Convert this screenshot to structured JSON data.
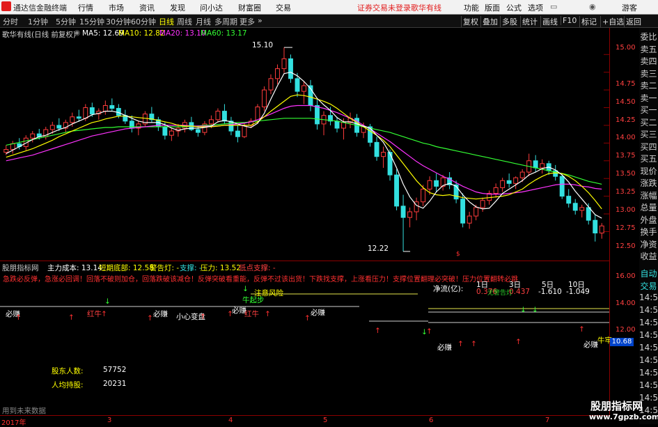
{
  "menubar": {
    "app_title": "通达信金融终端",
    "items": [
      "行情",
      "市场",
      "资讯",
      "发现",
      "问小达",
      "财富圈",
      "交易"
    ],
    "warning": "证券交易未登录",
    "stock_tag": "歌华有线",
    "right_items": [
      "功能",
      "版面",
      "公式",
      "选项"
    ],
    "user": "游客"
  },
  "toolbar": {
    "periods": [
      "分时",
      "1分钟",
      "5分钟",
      "15分钟",
      "30分钟",
      "60分钟",
      "日线",
      "周线",
      "月线",
      "多周期",
      "更多"
    ],
    "selected_period": "日线",
    "buttons": [
      "复权",
      "叠加",
      "多股",
      "统计",
      "画线",
      "F10",
      "标记",
      "+自选",
      "返回"
    ]
  },
  "infobar": {
    "title": "歌华有线(日线 前复权)",
    "ma5": "MA5: 12.69",
    "ma10": "MA10: 12.82",
    "ma20": "MA20: 13.10",
    "ma60": "MA60: 13.17"
  },
  "annotations": {
    "high": "15.10",
    "low": "12.22",
    "marker": "$"
  },
  "price_axis": [
    "15.00",
    "14.75",
    "14.50",
    "14.25",
    "14.00",
    "13.75",
    "13.50",
    "13.25",
    "13.00",
    "12.75",
    "12.50"
  ],
  "indicator_header": {
    "name": "股朋指标网",
    "cost": "主力成本: 13.14",
    "bottom": "短期底部: 12.58",
    "alarm": "警告灯: -",
    "support": "支撑: -",
    "pressure": "压力: 13.52",
    "low_support": "低点支撑: -"
  },
  "indicator_banner": "急跌必反弹，急涨必回调！回落不破则加仓，回落跌破该减仓！反弹突破看重能，反弹不过该出货！下跌找支撑，上涨看压力！支撑位置翻理必突破！压力位置翻转必跳跃！",
  "indicator_labels": {
    "careful": "小心变盘",
    "risk": "注意风险",
    "bull": "牛起步",
    "must_earn": "必赚",
    "red_cow": "红牛",
    "bull_strong": "牛牢"
  },
  "net_flow": {
    "label": "净流(亿):",
    "periods": [
      "1日",
      "3日",
      "5日",
      "10日"
    ],
    "values": [
      "0.376",
      "0.437",
      "-1.610",
      "-1.049"
    ],
    "extra": "无警告灯"
  },
  "holders": {
    "count_label": "股东人数:",
    "count_value": "57752",
    "avg_label": "人均持股:",
    "avg_value": "20231"
  },
  "indicator_axis": [
    "16.00",
    "14.00",
    "12.00"
  ],
  "indicator_value": "10.68",
  "hint": "用到未来数据",
  "dates": [
    "2017年",
    "3",
    "4",
    "5",
    "6",
    "7"
  ],
  "right_panel": {
    "top": [
      "委比",
      "卖五",
      "卖四",
      "卖三",
      "卖二",
      "卖一",
      "买一",
      "买二",
      "买三",
      "买四",
      "买五",
      "现价",
      "涨跌",
      "涨幅",
      "总量",
      "外盘",
      "换手",
      "净资",
      "收益"
    ],
    "bottom": [
      "自动",
      "交易",
      "14:5",
      "14:5",
      "14:5",
      "14:5",
      "14:5",
      "14:5",
      "14:5",
      "14:5",
      "14:5",
      "14:5"
    ]
  },
  "watermark": {
    "cn": "股朋指标网",
    "url": "www.7gpzb.com"
  },
  "colors": {
    "up": "#ff3c3c",
    "down": "#33e0e0",
    "ma5": "#ffffff",
    "ma10": "#ffff00",
    "ma20": "#ff33ff",
    "ma60": "#33ff33",
    "axis": "#8b0000"
  },
  "chart_data": {
    "type": "candlestick",
    "ohlc": [
      [
        13.62,
        13.72,
        13.58,
        13.66
      ],
      [
        13.66,
        13.78,
        13.6,
        13.74
      ],
      [
        13.74,
        13.82,
        13.66,
        13.7
      ],
      [
        13.7,
        13.86,
        13.65,
        13.82
      ],
      [
        13.82,
        13.92,
        13.76,
        13.88
      ],
      [
        13.88,
        13.95,
        13.8,
        13.84
      ],
      [
        13.84,
        13.98,
        13.8,
        13.94
      ],
      [
        13.94,
        14.05,
        13.88,
        14.0
      ],
      [
        14.0,
        14.1,
        13.92,
        13.96
      ],
      [
        13.96,
        14.08,
        13.9,
        14.04
      ],
      [
        14.04,
        14.18,
        13.98,
        14.12
      ],
      [
        14.12,
        14.22,
        14.05,
        14.1
      ],
      [
        14.1,
        14.3,
        14.06,
        14.25
      ],
      [
        14.25,
        14.32,
        14.12,
        14.16
      ],
      [
        14.16,
        14.24,
        14.08,
        14.2
      ],
      [
        14.2,
        14.35,
        14.15,
        14.28
      ],
      [
        14.28,
        14.38,
        14.2,
        14.24
      ],
      [
        14.24,
        14.3,
        14.1,
        14.14
      ],
      [
        14.14,
        14.22,
        14.02,
        14.06
      ],
      [
        14.06,
        14.14,
        13.9,
        13.96
      ],
      [
        13.96,
        14.06,
        13.86,
        14.02
      ],
      [
        14.02,
        14.2,
        13.98,
        14.16
      ],
      [
        14.16,
        14.26,
        14.04,
        14.08
      ],
      [
        14.08,
        14.12,
        13.92,
        13.98
      ],
      [
        13.98,
        14.04,
        13.8,
        13.86
      ],
      [
        13.86,
        13.96,
        13.78,
        13.92
      ],
      [
        13.92,
        14.02,
        13.84,
        13.96
      ],
      [
        13.96,
        14.08,
        13.9,
        14.04
      ],
      [
        14.04,
        14.12,
        13.92,
        13.94
      ],
      [
        13.94,
        14.0,
        13.84,
        13.9
      ],
      [
        13.9,
        14.06,
        13.86,
        14.02
      ],
      [
        14.02,
        14.14,
        13.96,
        14.08
      ],
      [
        14.08,
        14.24,
        14.04,
        14.2
      ],
      [
        14.2,
        14.3,
        14.02,
        14.06
      ],
      [
        14.06,
        14.12,
        13.86,
        13.92
      ],
      [
        13.92,
        14.0,
        13.76,
        13.84
      ],
      [
        13.84,
        14.04,
        13.82,
        14.0
      ],
      [
        14.0,
        14.1,
        13.96,
        14.06
      ],
      [
        14.06,
        14.3,
        14.02,
        14.26
      ],
      [
        14.26,
        14.55,
        14.2,
        14.5
      ],
      [
        14.5,
        14.72,
        14.44,
        14.66
      ],
      [
        14.66,
        14.86,
        14.58,
        14.8
      ],
      [
        14.8,
        15.1,
        14.74,
        14.94
      ],
      [
        14.94,
        15.0,
        14.6,
        14.66
      ],
      [
        14.66,
        14.74,
        14.4,
        14.48
      ],
      [
        14.48,
        14.62,
        14.3,
        14.56
      ],
      [
        14.56,
        14.64,
        14.2,
        14.28
      ],
      [
        14.28,
        14.36,
        13.94,
        14.02
      ],
      [
        14.02,
        14.2,
        13.86,
        14.14
      ],
      [
        14.14,
        14.26,
        14.0,
        14.06
      ],
      [
        14.06,
        14.12,
        13.9,
        13.96
      ],
      [
        13.96,
        14.1,
        13.8,
        14.04
      ],
      [
        14.04,
        14.18,
        13.96,
        14.1
      ],
      [
        14.1,
        14.16,
        13.84,
        13.9
      ],
      [
        13.9,
        14.04,
        13.82,
        13.98
      ],
      [
        13.98,
        14.02,
        13.7,
        13.76
      ],
      [
        13.76,
        13.84,
        13.5,
        13.56
      ],
      [
        13.56,
        13.7,
        13.4,
        13.62
      ],
      [
        13.62,
        13.66,
        13.22,
        13.3
      ],
      [
        13.3,
        13.38,
        12.8,
        12.86
      ],
      [
        12.86,
        13.02,
        12.22,
        12.7
      ],
      [
        12.7,
        12.84,
        12.56,
        12.78
      ],
      [
        12.78,
        12.98,
        12.66,
        12.92
      ],
      [
        12.92,
        13.16,
        12.86,
        13.1
      ],
      [
        13.1,
        13.28,
        13.02,
        13.22
      ],
      [
        13.22,
        13.32,
        13.06,
        13.14
      ],
      [
        13.14,
        13.3,
        13.08,
        13.26
      ],
      [
        13.26,
        13.34,
        13.1,
        13.16
      ],
      [
        13.16,
        13.22,
        12.9,
        12.96
      ],
      [
        12.96,
        13.04,
        12.56,
        12.62
      ],
      [
        12.62,
        12.78,
        12.54,
        12.72
      ],
      [
        12.72,
        12.88,
        12.66,
        12.84
      ],
      [
        12.84,
        12.98,
        12.78,
        12.94
      ],
      [
        12.94,
        13.08,
        12.88,
        13.04
      ],
      [
        13.04,
        13.18,
        12.98,
        13.12
      ],
      [
        13.12,
        13.26,
        13.06,
        13.22
      ],
      [
        13.22,
        13.32,
        13.12,
        13.18
      ],
      [
        13.18,
        13.28,
        13.1,
        13.26
      ],
      [
        13.26,
        13.38,
        13.2,
        13.34
      ],
      [
        13.34,
        13.6,
        13.28,
        13.5
      ],
      [
        13.5,
        13.58,
        13.34,
        13.4
      ],
      [
        13.4,
        13.52,
        13.32,
        13.46
      ],
      [
        13.46,
        13.5,
        13.3,
        13.36
      ],
      [
        13.36,
        13.44,
        13.22,
        13.28
      ],
      [
        13.28,
        13.32,
        12.96,
        13.0
      ],
      [
        13.0,
        13.1,
        12.84,
        12.9
      ],
      [
        12.9,
        12.96,
        12.74,
        12.8
      ],
      [
        12.8,
        12.88,
        12.7,
        12.84
      ],
      [
        12.84,
        12.9,
        12.6,
        12.66
      ],
      [
        12.66,
        12.74,
        12.36,
        12.48
      ],
      [
        12.48,
        12.62,
        12.4,
        12.58
      ]
    ],
    "ma5": [
      13.6,
      13.65,
      13.7,
      13.75,
      13.8,
      13.84,
      13.86,
      13.9,
      13.94,
      13.97,
      14.02,
      14.06,
      14.1,
      14.15,
      14.17,
      14.2,
      14.2,
      14.18,
      14.14,
      14.1,
      14.06,
      14.04,
      14.04,
      14.04,
      14.01,
      13.96,
      13.93,
      13.95,
      13.96,
      13.96,
      13.97,
      13.99,
      14.05,
      14.07,
      14.05,
      14.02,
      13.99,
      13.97,
      14.03,
      14.17,
      14.37,
      14.56,
      14.73,
      14.75,
      14.7,
      14.62,
      14.52,
      14.38,
      14.29,
      14.21,
      14.11,
      14.05,
      14.05,
      14.02,
      13.99,
      13.96,
      13.86,
      13.76,
      13.6,
      13.4,
      13.17,
      12.99,
      12.87,
      12.83,
      12.93,
      13.06,
      13.15,
      13.18,
      13.14,
      13.02,
      12.92,
      12.85,
      12.82,
      12.83,
      12.93,
      13.04,
      13.1,
      13.16,
      13.22,
      13.3,
      13.34,
      13.39,
      13.41,
      13.37,
      13.3,
      13.2,
      13.07,
      12.96,
      12.85,
      12.74,
      12.69
    ],
    "ma10": [
      13.55,
      13.58,
      13.61,
      13.64,
      13.67,
      13.71,
      13.75,
      13.79,
      13.84,
      13.88,
      13.92,
      13.96,
      14.0,
      14.04,
      14.06,
      14.09,
      14.11,
      14.13,
      14.13,
      14.12,
      14.11,
      14.1,
      14.09,
      14.07,
      14.05,
      14.03,
      14.0,
      13.99,
      13.99,
      13.98,
      13.98,
      13.98,
      13.99,
      14.0,
      14.0,
      14.0,
      14.0,
      14.0,
      14.05,
      14.12,
      14.2,
      14.27,
      14.34,
      14.41,
      14.43,
      14.42,
      14.4,
      14.37,
      14.34,
      14.3,
      14.24,
      14.17,
      14.1,
      14.04,
      13.98,
      13.92,
      13.86,
      13.79,
      13.7,
      13.58,
      13.46,
      13.34,
      13.22,
      13.12,
      13.05,
      13.02,
      13.01,
      13.02,
      13.0,
      12.98,
      12.97,
      12.96,
      12.97,
      12.98,
      12.99,
      13.0,
      13.02,
      13.06,
      13.1,
      13.17,
      13.23,
      13.28,
      13.32,
      13.33,
      13.32,
      13.28,
      13.22,
      13.14,
      13.05,
      12.94,
      12.82
    ],
    "ma20": [
      13.5,
      13.52,
      13.54,
      13.56,
      13.58,
      13.61,
      13.64,
      13.67,
      13.7,
      13.73,
      13.76,
      13.79,
      13.82,
      13.85,
      13.87,
      13.89,
      13.91,
      13.93,
      13.95,
      13.96,
      13.97,
      13.98,
      13.99,
      14.0,
      14.0,
      14.0,
      14.0,
      14.0,
      13.99,
      13.99,
      13.99,
      13.99,
      13.99,
      14.0,
      14.01,
      14.02,
      14.03,
      14.05,
      14.08,
      14.12,
      14.16,
      14.2,
      14.24,
      14.27,
      14.28,
      14.28,
      14.28,
      14.26,
      14.24,
      14.21,
      14.18,
      14.14,
      14.1,
      14.06,
      14.0,
      13.95,
      13.89,
      13.83,
      13.77,
      13.7,
      13.63,
      13.56,
      13.49,
      13.43,
      13.38,
      13.33,
      13.28,
      13.24,
      13.19,
      13.14,
      13.1,
      13.06,
      13.04,
      13.03,
      13.03,
      13.03,
      13.04,
      13.05,
      13.06,
      13.08,
      13.1,
      13.12,
      13.14,
      13.16,
      13.17,
      13.17,
      13.16,
      13.14,
      13.13,
      13.11,
      13.1
    ],
    "ma60": [
      13.72,
      13.74,
      13.76,
      13.78,
      13.8,
      13.82,
      13.84,
      13.86,
      13.88,
      13.9,
      13.92,
      13.93,
      13.94,
      13.95,
      13.96,
      13.97,
      13.97,
      13.98,
      13.98,
      13.98,
      13.98,
      13.98,
      13.98,
      13.98,
      13.98,
      13.98,
      13.98,
      13.98,
      13.99,
      13.99,
      14.0,
      14.0,
      14.01,
      14.02,
      14.03,
      14.04,
      14.04,
      14.05,
      14.06,
      14.07,
      14.08,
      14.09,
      14.1,
      14.1,
      14.1,
      14.1,
      14.1,
      14.09,
      14.08,
      14.07,
      14.06,
      14.04,
      14.02,
      14.0,
      13.98,
      13.96,
      13.94,
      13.92,
      13.9,
      13.87,
      13.84,
      13.81,
      13.78,
      13.75,
      13.73,
      13.7,
      13.68,
      13.66,
      13.64,
      13.62,
      13.6,
      13.58,
      13.56,
      13.54,
      13.52,
      13.5,
      13.48,
      13.46,
      13.44,
      13.42,
      13.4,
      13.38,
      13.36,
      13.34,
      13.32,
      13.3,
      13.27,
      13.24,
      13.21,
      13.19,
      13.17
    ],
    "ylim": [
      12.2,
      15.15
    ]
  }
}
